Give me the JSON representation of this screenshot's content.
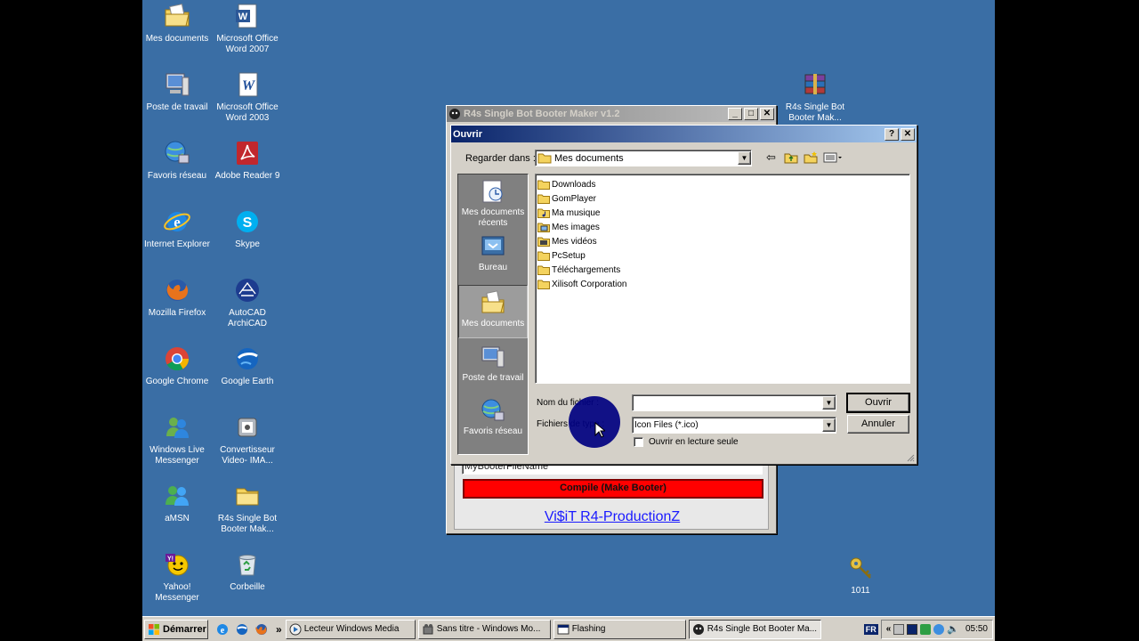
{
  "desktop_icons": [
    {
      "label": "Mes documents",
      "icon": "my-documents-icon"
    },
    {
      "label": "Microsoft Office Word 2007",
      "icon": "word-icon"
    },
    {
      "label": "Poste de travail",
      "icon": "my-computer-icon"
    },
    {
      "label": "Microsoft Office Word 2003",
      "icon": "word-icon"
    },
    {
      "label": "Favoris réseau",
      "icon": "network-icon"
    },
    {
      "label": "Adobe Reader 9",
      "icon": "adobe-reader-icon"
    },
    {
      "label": "Internet Explorer",
      "icon": "internet-explorer-icon"
    },
    {
      "label": "Skype",
      "icon": "skype-icon"
    },
    {
      "label": "Mozilla Firefox",
      "icon": "firefox-icon"
    },
    {
      "label": "AutoCAD ArchiCAD",
      "icon": "autocad-icon"
    },
    {
      "label": "Google Chrome",
      "icon": "chrome-icon"
    },
    {
      "label": "Google Earth",
      "icon": "google-earth-icon"
    },
    {
      "label": "Windows Live Messenger",
      "icon": "messenger-icon"
    },
    {
      "label": "Convertisseur Video- IMA...",
      "icon": "video-converter-icon"
    },
    {
      "label": "aMSN",
      "icon": "amsn-icon"
    },
    {
      "label": "R4s Single Bot Booter Mak...",
      "icon": "folder-icon"
    },
    {
      "label": "Yahoo! Messenger",
      "icon": "yahoo-messenger-icon"
    },
    {
      "label": "Corbeille",
      "icon": "recycle-bin-icon"
    },
    {
      "label": "R4s Single Bot Booter Mak...",
      "icon": "winrar-icon"
    },
    {
      "label": "1011",
      "icon": "keys-icon"
    }
  ],
  "app_window": {
    "title": "R4s Single Bot Booter Maker v1.2",
    "filename_value": "MyBooterFileName",
    "compile_label": "Compile (Make Booter)",
    "link_label": "Vi$iT R4-ProductionZ",
    "compile_color": "#ff0000"
  },
  "dialog": {
    "title": "Ouvrir",
    "help_btn": "?",
    "close_btn": "✕",
    "look_in_label": "Regarder dans :",
    "look_in_value": "Mes documents",
    "places": [
      {
        "label": "Mes documents récents",
        "icon": "recent-documents-icon"
      },
      {
        "label": "Bureau",
        "icon": "desktop-icon"
      },
      {
        "label": "Mes documents",
        "icon": "my-documents-icon"
      },
      {
        "label": "Poste de travail",
        "icon": "my-computer-icon"
      },
      {
        "label": "Favoris réseau",
        "icon": "network-icon"
      }
    ],
    "files": [
      {
        "name": "Downloads",
        "icon": "folder-icon"
      },
      {
        "name": "GomPlayer",
        "icon": "folder-icon"
      },
      {
        "name": "Ma musique",
        "icon": "music-folder-icon"
      },
      {
        "name": "Mes images",
        "icon": "pictures-folder-icon"
      },
      {
        "name": "Mes vidéos",
        "icon": "videos-folder-icon"
      },
      {
        "name": "PcSetup",
        "icon": "folder-icon"
      },
      {
        "name": "Téléchargements",
        "icon": "folder-icon"
      },
      {
        "name": "Xilisoft Corporation",
        "icon": "folder-icon"
      }
    ],
    "filename_label": "Nom du fichier :",
    "filename_value": "",
    "filetype_label": "Fichiers de type :",
    "filetype_value": "Icon Files (*.ico)",
    "readonly_label": "Ouvrir en lecture seule",
    "readonly_checked": false,
    "open_btn": "Ouvrir",
    "cancel_btn": "Annuler"
  },
  "taskbar": {
    "start_label": "Démarrer",
    "quicklaunch_more": "»",
    "tasks": [
      {
        "label": "Lecteur Windows Media",
        "icon": "media-player-icon"
      },
      {
        "label": "Sans titre - Windows Mo...",
        "icon": "movie-maker-icon"
      },
      {
        "label": "Flashing",
        "icon": "window-icon"
      },
      {
        "label": "R4s Single Bot Booter Ma...",
        "icon": "app-icon"
      }
    ],
    "lang": "FR",
    "tray_more": "«",
    "clock": "05:50"
  }
}
